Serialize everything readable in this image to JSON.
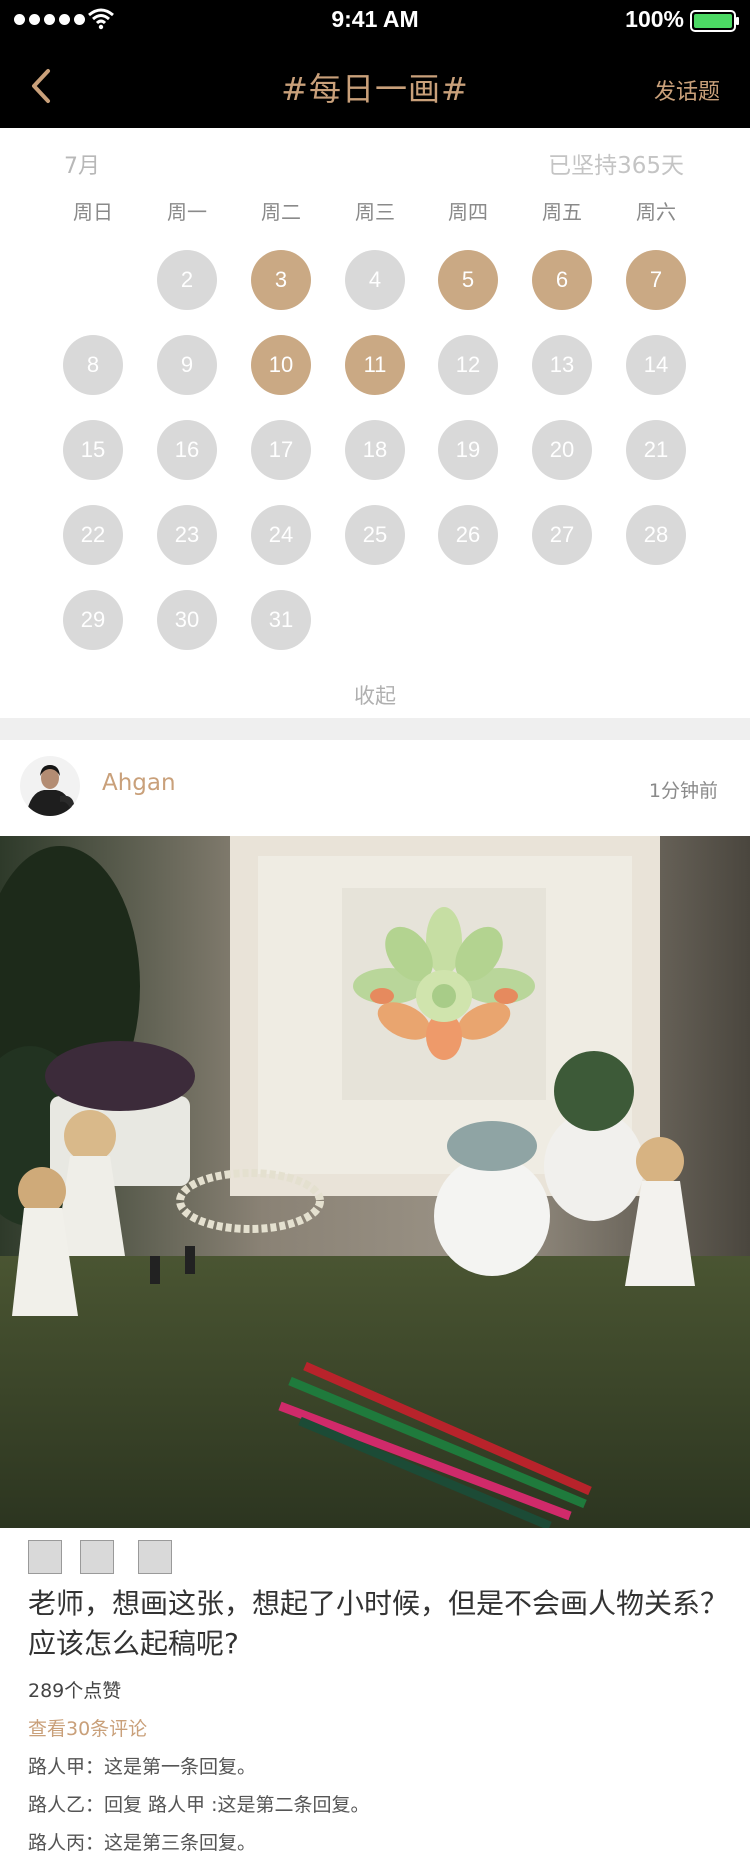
{
  "status_bar": {
    "time": "9:41 AM",
    "battery": "100%"
  },
  "nav": {
    "title": "#每日一画#",
    "action": "发话题",
    "back_icon": "chevron-left-icon"
  },
  "calendar": {
    "month": "7月",
    "streak": "已坚持365天",
    "weekdays": [
      "周日",
      "周一",
      "周二",
      "周三",
      "周四",
      "周五",
      "周六"
    ],
    "days": [
      {
        "n": "2",
        "active": false
      },
      {
        "n": "3",
        "active": true
      },
      {
        "n": "4",
        "active": false
      },
      {
        "n": "5",
        "active": true
      },
      {
        "n": "6",
        "active": true
      },
      {
        "n": "7",
        "active": true
      },
      {
        "n": "8",
        "active": false
      },
      {
        "n": "9",
        "active": false
      },
      {
        "n": "10",
        "active": true
      },
      {
        "n": "11",
        "active": true
      },
      {
        "n": "12",
        "active": false
      },
      {
        "n": "13",
        "active": false
      },
      {
        "n": "14",
        "active": false
      },
      {
        "n": "15",
        "active": false
      },
      {
        "n": "16",
        "active": false
      },
      {
        "n": "17",
        "active": false
      },
      {
        "n": "18",
        "active": false
      },
      {
        "n": "19",
        "active": false
      },
      {
        "n": "20",
        "active": false
      },
      {
        "n": "21",
        "active": false
      },
      {
        "n": "22",
        "active": false
      },
      {
        "n": "23",
        "active": false
      },
      {
        "n": "24",
        "active": false
      },
      {
        "n": "25",
        "active": false
      },
      {
        "n": "26",
        "active": false
      },
      {
        "n": "27",
        "active": false
      },
      {
        "n": "28",
        "active": false
      },
      {
        "n": "29",
        "active": false
      },
      {
        "n": "30",
        "active": false
      },
      {
        "n": "31",
        "active": false
      }
    ],
    "collapse_label": "收起"
  },
  "post": {
    "username": "Ahgan",
    "time": "1分钟前",
    "caption": "老师，想画这张，想起了小时候，但是不会画人物关系？应该怎么起稿呢?",
    "likes": "289个点赞",
    "view_comments": "查看30条评论",
    "comments": [
      "路人甲：这是第一条回复。",
      "路人乙：回复 路人甲 :这是第二条回复。",
      "路人丙：这是第三条回复。"
    ]
  },
  "colors": {
    "accent": "#c9a07a",
    "active_day": "#caa984",
    "inactive_day": "#d9d9d9"
  }
}
